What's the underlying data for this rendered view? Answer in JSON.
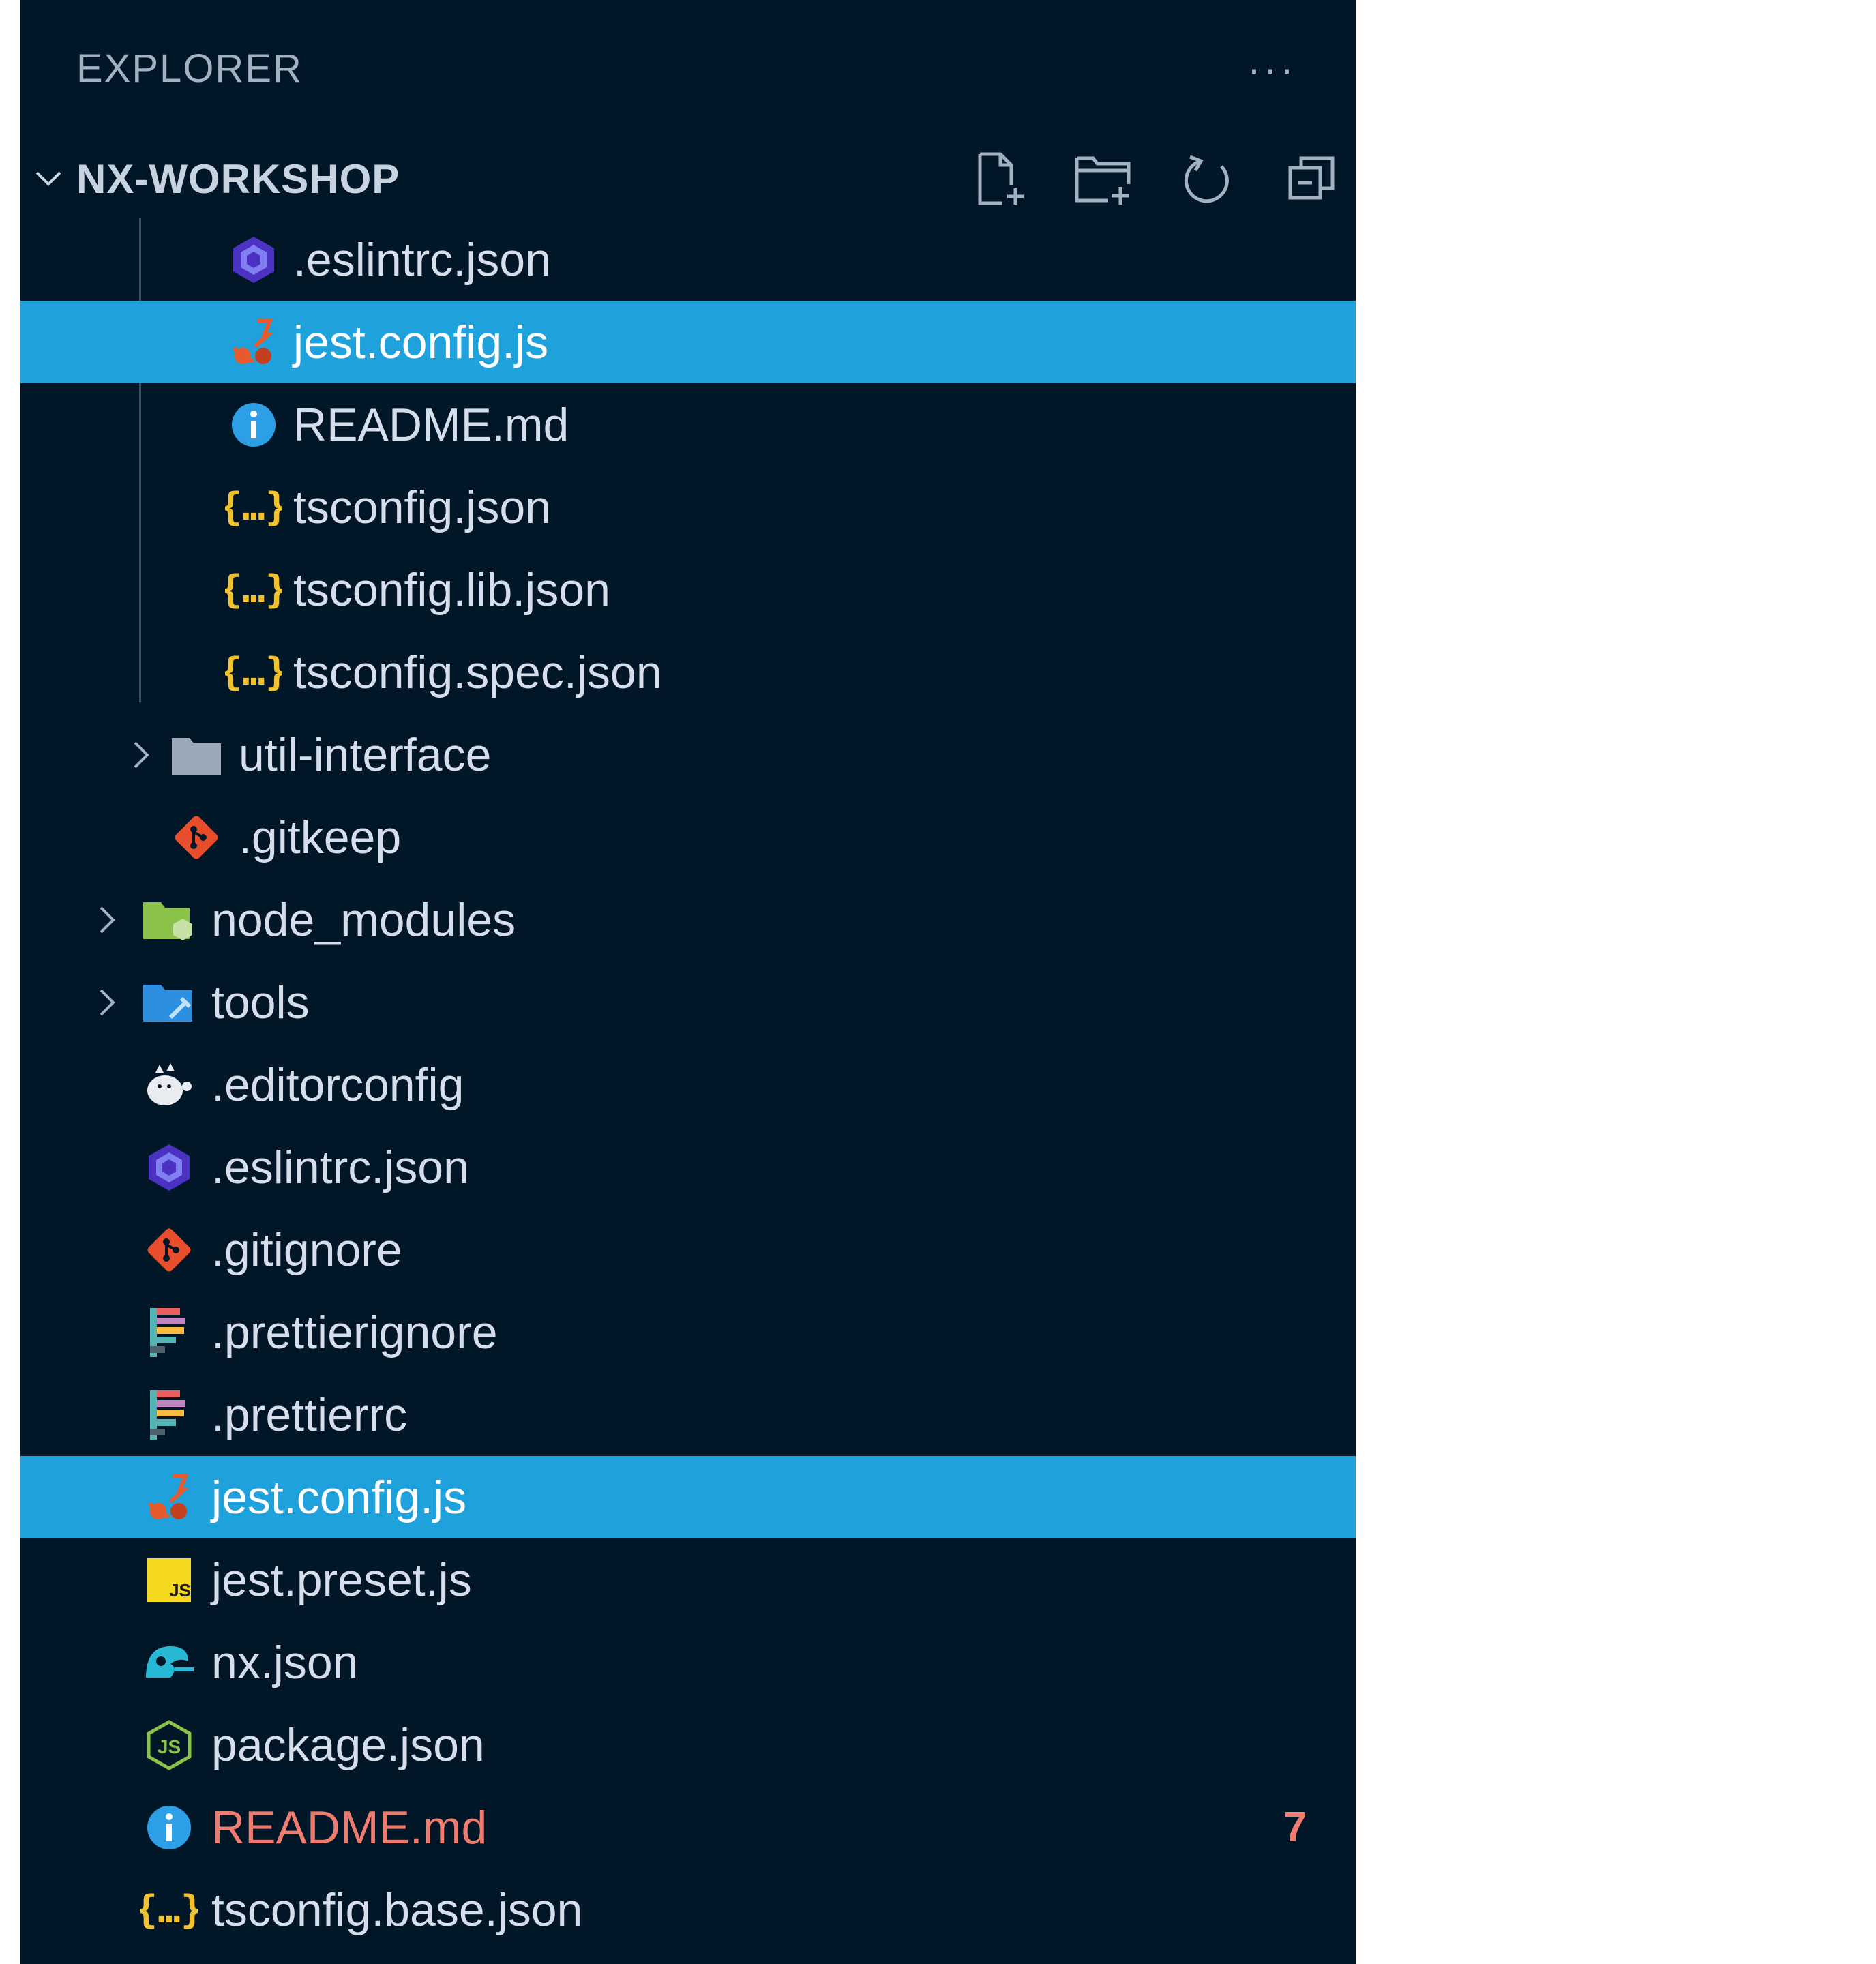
{
  "explorer": {
    "title": "EXPLORER",
    "more_label": "···"
  },
  "section": {
    "title": "NX-WORKSHOP",
    "actions": [
      {
        "name": "new-file",
        "icon": "new-file-icon"
      },
      {
        "name": "new-folder",
        "icon": "new-folder-icon"
      },
      {
        "name": "refresh",
        "icon": "refresh-icon"
      },
      {
        "name": "collapse-all",
        "icon": "collapse-all-icon"
      }
    ]
  },
  "tree": {
    "items": [
      {
        "label": ".eslintrc.json",
        "icon": "eslint-icon",
        "depth": 3
      },
      {
        "label": "jest.config.js",
        "icon": "jest-icon",
        "depth": 3,
        "selected": true
      },
      {
        "label": "README.md",
        "icon": "info-icon",
        "depth": 3
      },
      {
        "label": "tsconfig.json",
        "icon": "json-icon",
        "depth": 3
      },
      {
        "label": "tsconfig.lib.json",
        "icon": "json-icon",
        "depth": 3
      },
      {
        "label": "tsconfig.spec.json",
        "icon": "json-icon",
        "depth": 3
      },
      {
        "label": "util-interface",
        "icon": "folder-icon",
        "depth": 2,
        "folder": true
      },
      {
        "label": ".gitkeep",
        "icon": "git-icon",
        "depth": 2
      },
      {
        "label": "node_modules",
        "icon": "node-folder-icon",
        "depth": 1,
        "folder": true
      },
      {
        "label": "tools",
        "icon": "tools-folder-icon",
        "depth": 1,
        "folder": true
      },
      {
        "label": ".editorconfig",
        "icon": "editorconfig-icon",
        "depth": 1
      },
      {
        "label": ".eslintrc.json",
        "icon": "eslint-icon",
        "depth": 1
      },
      {
        "label": ".gitignore",
        "icon": "git-icon",
        "depth": 1
      },
      {
        "label": ".prettierignore",
        "icon": "prettier-icon",
        "depth": 1
      },
      {
        "label": ".prettierrc",
        "icon": "prettier-icon",
        "depth": 1
      },
      {
        "label": "jest.config.js",
        "icon": "jest-icon",
        "depth": 1,
        "selected": true
      },
      {
        "label": "jest.preset.js",
        "icon": "js-icon",
        "depth": 1
      },
      {
        "label": "nx.json",
        "icon": "nx-icon",
        "depth": 1
      },
      {
        "label": "package.json",
        "icon": "nodejs-icon",
        "depth": 1
      },
      {
        "label": "README.md",
        "icon": "info-icon",
        "depth": 1,
        "modified": true,
        "badge": "7"
      },
      {
        "label": "tsconfig.base.json",
        "icon": "json-icon",
        "depth": 1
      }
    ]
  },
  "colors": {
    "background": "#011627",
    "selection": "#1fa2dc",
    "text": "#d6deeb",
    "modified": "#ef7d6f"
  }
}
